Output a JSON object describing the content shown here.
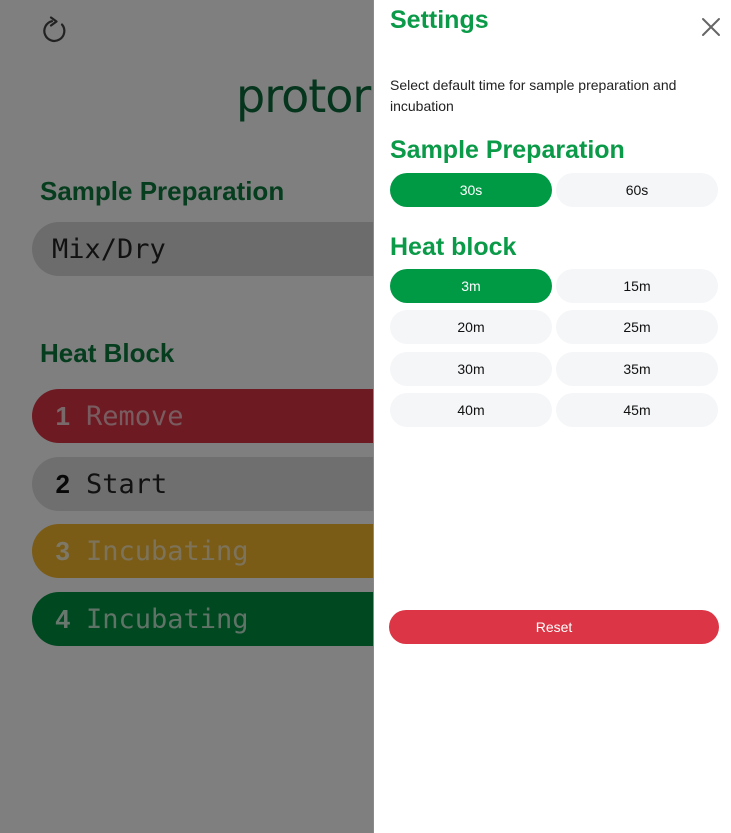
{
  "background": {
    "logo_text": "protor",
    "sample_prep": {
      "title": "Sample Preparation",
      "value": "Mix/Dry"
    },
    "heat_block": {
      "title": "Heat Block",
      "items": [
        {
          "num": "1",
          "label": "Remove",
          "color": "#dc3545"
        },
        {
          "num": "2",
          "label": "Start",
          "color": "#dedede"
        },
        {
          "num": "3",
          "label": "Incubating",
          "color": "#f5b82e"
        },
        {
          "num": "4",
          "label": "Incubating",
          "color": "#009040"
        }
      ]
    }
  },
  "settings": {
    "title": "Settings",
    "description": "Select default time for sample preparation and incubation",
    "sample_preparation": {
      "title": "Sample Preparation",
      "options": [
        "30s",
        "60s"
      ],
      "selected": "30s"
    },
    "heat_block": {
      "title": "Heat block",
      "options": [
        "3m",
        "15m",
        "20m",
        "25m",
        "30m",
        "35m",
        "40m",
        "45m"
      ],
      "selected": "3m"
    },
    "reset_label": "Reset"
  },
  "colors": {
    "accent_green": "#009a45",
    "danger_red": "#dc3545"
  },
  "icons": {
    "refresh": "refresh-icon",
    "close": "close-icon"
  }
}
